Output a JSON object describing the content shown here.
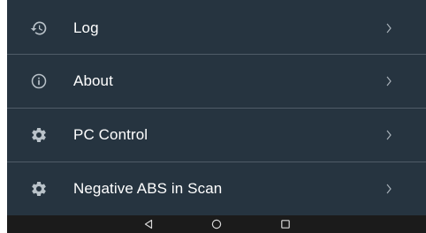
{
  "menu": {
    "items": [
      {
        "label": "Log",
        "icon": "history-icon"
      },
      {
        "label": "About",
        "icon": "info-icon"
      },
      {
        "label": "PC Control",
        "icon": "gear-icon"
      },
      {
        "label": "Negative ABS in Scan",
        "icon": "gear-icon"
      }
    ]
  },
  "colors": {
    "background": "#263440",
    "divider": "#4f5c67",
    "text": "#ffffff",
    "icon": "#b9c2c9",
    "navbar": "#1b1b1b"
  },
  "navbar": {
    "buttons": [
      "back-icon",
      "home-icon",
      "recents-icon"
    ]
  }
}
